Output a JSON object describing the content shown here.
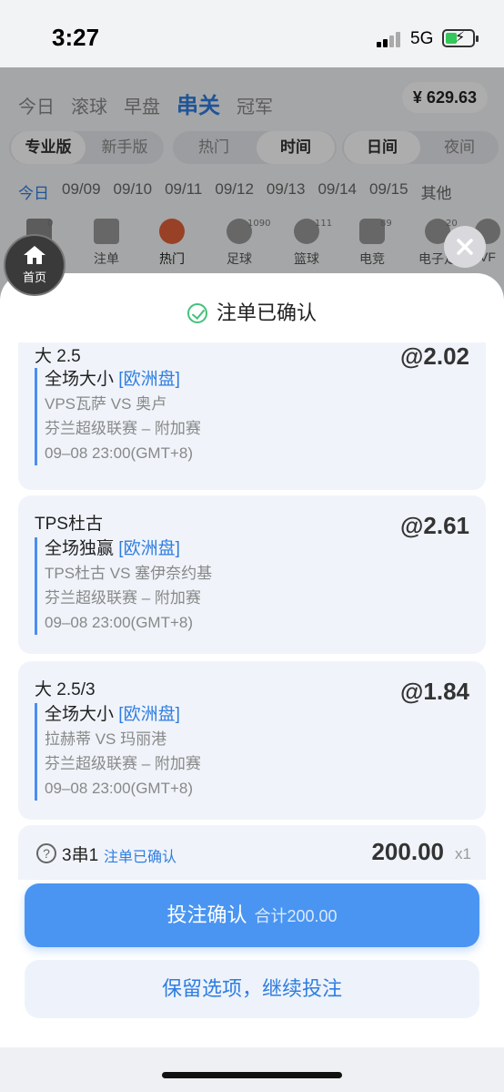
{
  "status_bar": {
    "time": "3:27",
    "network": "5G"
  },
  "background": {
    "tabs": [
      "今日",
      "滚球",
      "早盘",
      "串关",
      "冠军"
    ],
    "active_tab": "串关",
    "balance": "¥ 629.63",
    "modes": [
      "专业版",
      "新手版"
    ],
    "sorts": [
      "热门",
      "时间"
    ],
    "themes": [
      "日间",
      "夜间"
    ],
    "dates": [
      "今日",
      "09/09",
      "09/10",
      "09/11",
      "09/12",
      "09/13",
      "09/14",
      "09/15",
      "其他"
    ],
    "categories": [
      {
        "label": "",
        "count": "0"
      },
      {
        "label": "注单",
        "count": ""
      },
      {
        "label": "热门",
        "count": ""
      },
      {
        "label": "足球",
        "count": "1090"
      },
      {
        "label": "篮球",
        "count": "111"
      },
      {
        "label": "电竞",
        "count": "89"
      },
      {
        "label": "电子足",
        "count": "20"
      },
      {
        "label": "VF",
        "count": ""
      }
    ]
  },
  "home_button": {
    "label": "首页"
  },
  "sheet": {
    "title": "注单已确认",
    "bets": [
      {
        "selection": "大 2.5",
        "odds": "@2.02",
        "market": "全场大小",
        "market_tag": "[欧洲盘]",
        "match": "VPS瓦萨 VS 奥卢",
        "league": "芬兰超级联赛 – 附加赛",
        "time": "09–08 23:00(GMT+8)"
      },
      {
        "selection": "TPS杜古",
        "odds": "@2.61",
        "market": "全场独赢",
        "market_tag": "[欧洲盘]",
        "match": "TPS杜古 VS 塞伊奈约基",
        "league": "芬兰超级联赛 – 附加赛",
        "time": "09–08 23:00(GMT+8)"
      },
      {
        "selection": "大 2.5/3",
        "odds": "@1.84",
        "market": "全场大小",
        "market_tag": "[欧洲盘]",
        "match": "拉赫蒂 VS 玛丽港",
        "league": "芬兰超级联赛 – 附加赛",
        "time": "09–08 23:00(GMT+8)"
      }
    ],
    "summary": {
      "help": "?",
      "combo": "3串1",
      "status": "注单已确认",
      "amount": "200.00",
      "multiplier": "x1"
    },
    "confirm_button": {
      "label": "投注确认",
      "total": "合计200.00"
    },
    "keep_button": {
      "label": "保留选项，继续投注"
    }
  },
  "colors": {
    "accent": "#4a95f2",
    "link": "#2f7de1",
    "success": "#45c07c"
  }
}
